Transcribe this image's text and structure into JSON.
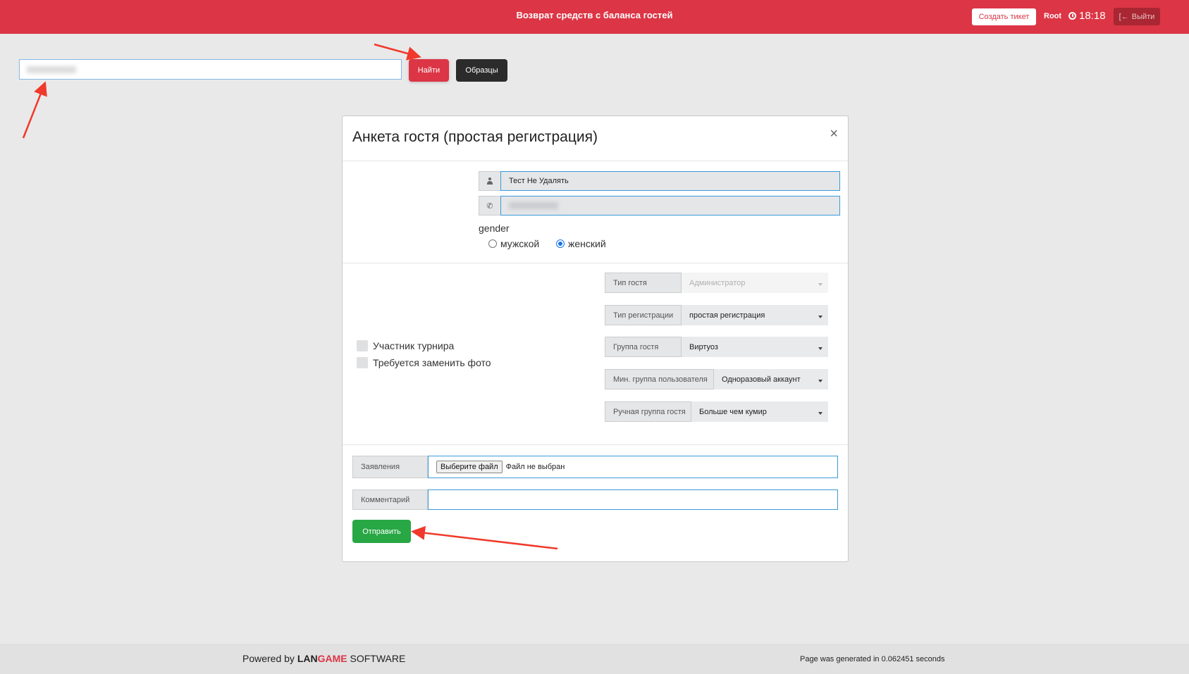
{
  "header": {
    "title": "Возврат средств с баланса гостей",
    "create_ticket_label": "Создать тикет",
    "user": "Root",
    "time": "18:18",
    "logout_label": "Выйти"
  },
  "search": {
    "value": "",
    "find_label": "Найти",
    "samples_label": "Образцы"
  },
  "modal": {
    "title": "Анкета гостя (простая регистрация)",
    "close_glyph": "×",
    "name_value": "Тест Не Удалять",
    "phone_value": "",
    "gender": {
      "label": "gender",
      "options": [
        "мужской",
        "женский"
      ],
      "selected": "женский"
    },
    "checkboxes": [
      {
        "label": "Участник турнира",
        "checked": false
      },
      {
        "label": "Требуется заменить фото",
        "checked": false
      }
    ],
    "selects": [
      {
        "label": "Тип гостя",
        "value": "Администратор",
        "disabled": true
      },
      {
        "label": "Тип регистрации",
        "value": "простая регистрация",
        "disabled": false
      },
      {
        "label": "Группа гостя",
        "value": "Виртуоз",
        "disabled": false
      },
      {
        "label": "Мин. группа пользователя",
        "value": "Одноразовый аккаунт",
        "disabled": false
      },
      {
        "label": "Ручная группа гостя",
        "value": "Больше чем кумир",
        "disabled": false
      }
    ],
    "file": {
      "label": "Заявления",
      "button_label": "Выберите файл",
      "status": "Файл не выбран"
    },
    "comment": {
      "label": "Комментарий",
      "value": ""
    },
    "submit_label": "Отправить"
  },
  "footer": {
    "powered_prefix": "Powered by",
    "brand_lan": "LAN",
    "brand_game": "GAME",
    "brand_suffix": "SOFTWARE",
    "generated_text": "Page was generated in 0.062451 seconds"
  },
  "colors": {
    "accent": "#dc3545",
    "success": "#28a745",
    "dark_button": "#2b2b2b",
    "annotation_arrow": "#f0392b"
  }
}
